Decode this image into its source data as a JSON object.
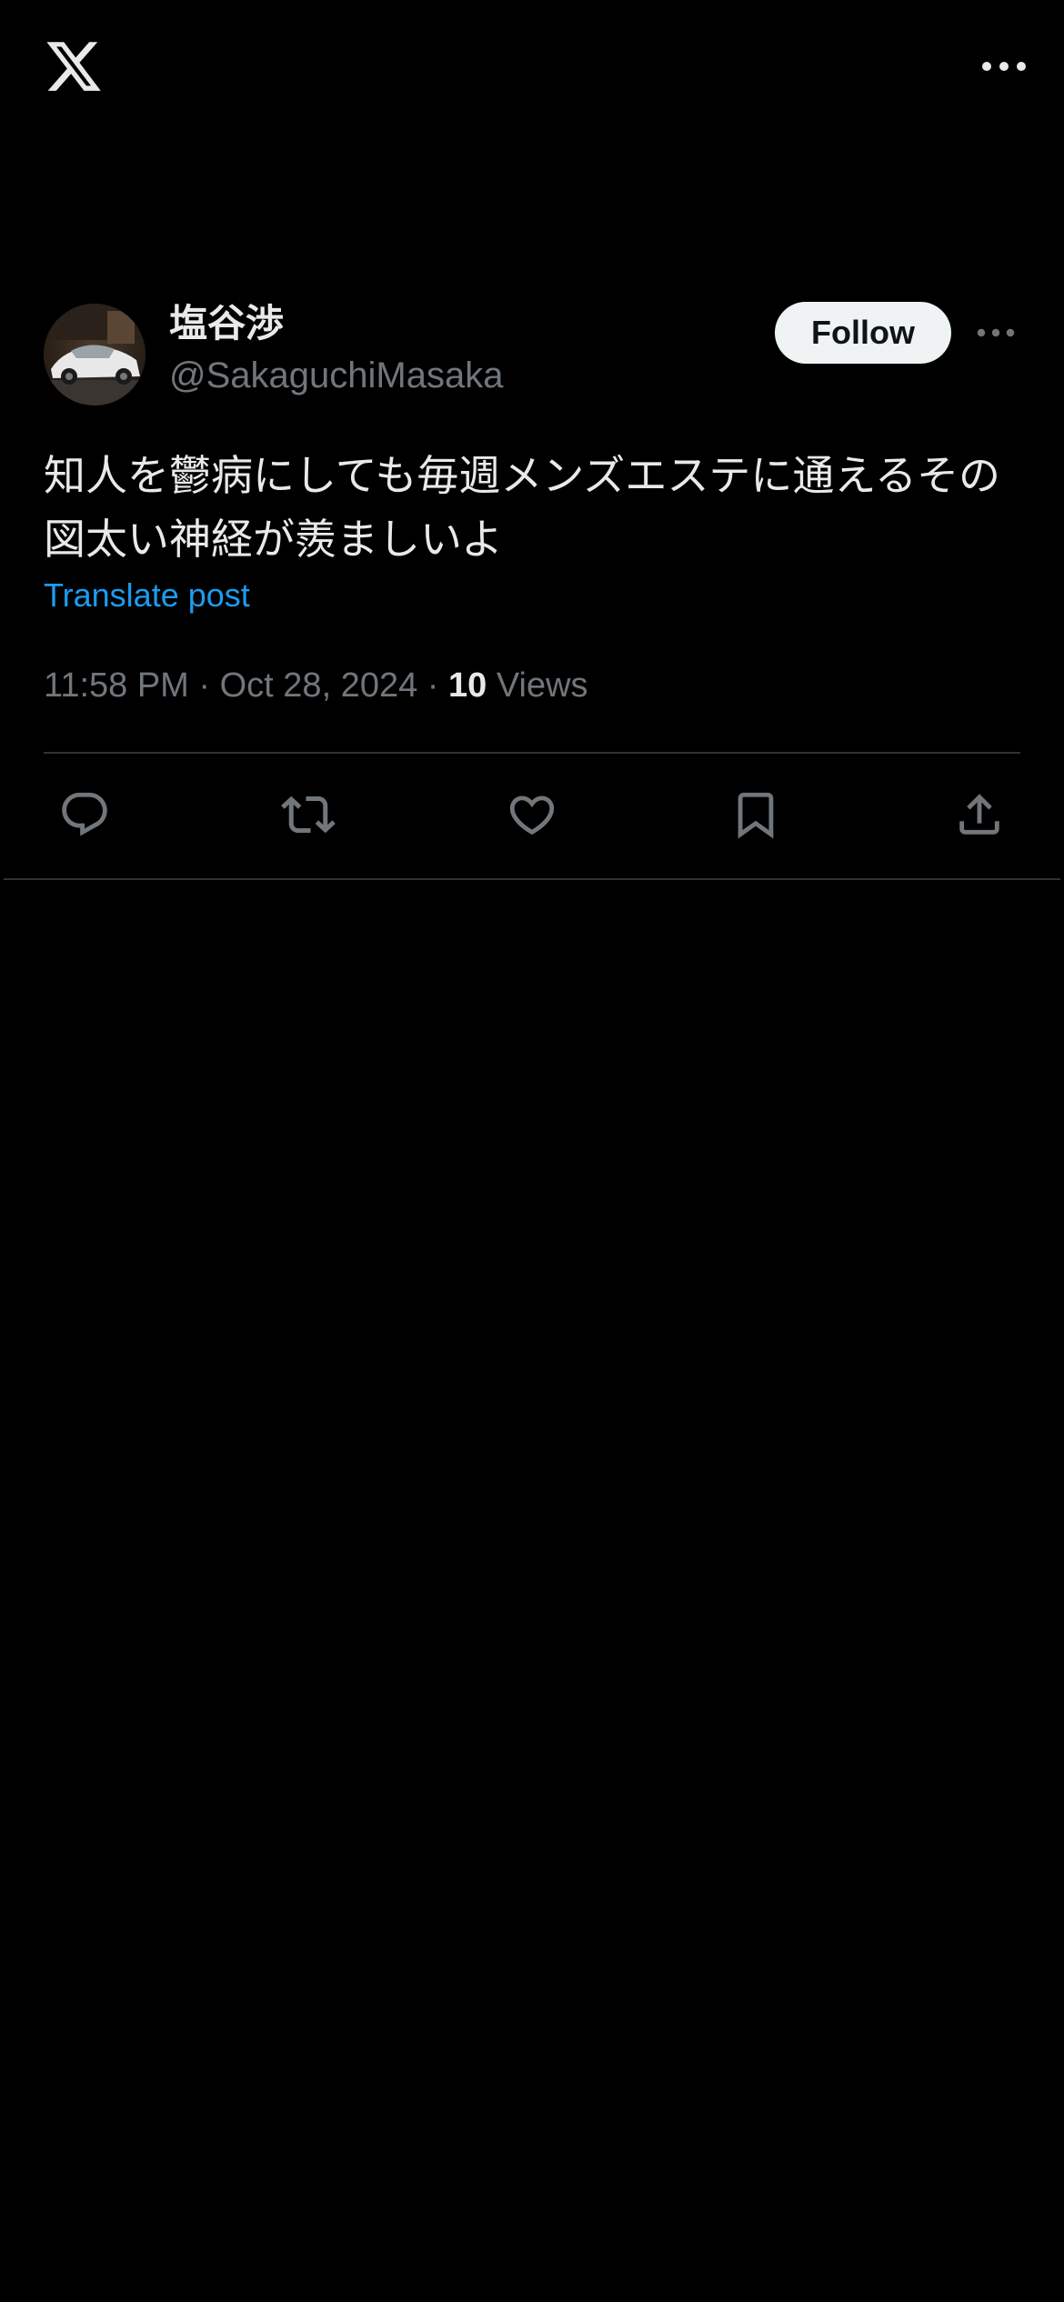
{
  "app": {
    "logo_icon": "x-logo-icon",
    "more_icon": "more-horizontal-icon"
  },
  "post": {
    "author": {
      "display_name": "塩谷渉",
      "handle": "@SakaguchiMasaka",
      "avatar_desc": "avatar"
    },
    "follow_label": "Follow",
    "text": "知人を鬱病にしても毎週メンズエステに通えるその図太い神経が羨ましいよ",
    "translate_label": "Translate post",
    "time": "11:58 PM",
    "date": "Oct 28, 2024",
    "separator": "·",
    "views_count": "10",
    "views_label": "Views"
  },
  "actions": [
    {
      "name": "reply",
      "icon": "reply-icon"
    },
    {
      "name": "repost",
      "icon": "repost-icon"
    },
    {
      "name": "like",
      "icon": "heart-icon"
    },
    {
      "name": "bookmark",
      "icon": "bookmark-icon"
    },
    {
      "name": "share",
      "icon": "share-icon"
    }
  ],
  "colors": {
    "background": "#000000",
    "text_primary": "#e7e9ea",
    "text_secondary": "#71767b",
    "link": "#1d9bf0",
    "divider": "#2f3336",
    "follow_bg": "#eff3f4",
    "follow_text": "#0f1419"
  }
}
